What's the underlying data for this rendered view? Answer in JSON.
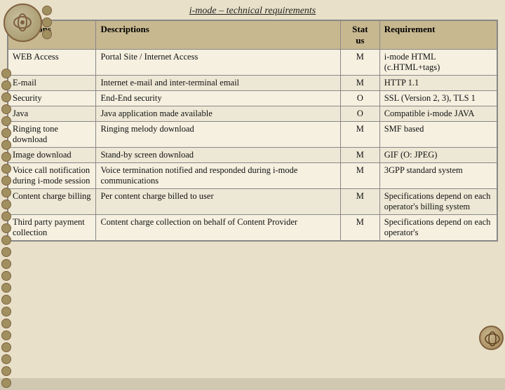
{
  "title": "i-mode – technical requirements",
  "headers": {
    "functions": "Functions",
    "descriptions": "Descriptions",
    "status": "Stat us",
    "requirement": "Requirement"
  },
  "rows": [
    {
      "function": "WEB Access",
      "description": "Portal Site / Internet Access",
      "status": "M",
      "requirement": "i-mode HTML (c.HTML+tags)"
    },
    {
      "function": "E-mail",
      "description": "Internet e-mail and inter-terminal email",
      "status": "M",
      "requirement": "HTTP 1.1"
    },
    {
      "function": "Security",
      "description": "End-End security",
      "status": "O",
      "requirement": "SSL (Version 2, 3), TLS 1"
    },
    {
      "function": "Java",
      "description": "Java application made available",
      "status": "O",
      "requirement": "Compatible i-mode JAVA"
    },
    {
      "function": "Ringing tone download",
      "description": "Ringing melody download",
      "status": "M",
      "requirement": "SMF based"
    },
    {
      "function": "Image download",
      "description": "Stand-by screen download",
      "status": "M",
      "requirement": "GIF (O: JPEG)"
    },
    {
      "function": "Voice call notification during i-mode session",
      "description": "Voice termination notified and responded during i-mode communications",
      "status": "M",
      "requirement": "3GPP standard system"
    },
    {
      "function": "Content charge billing",
      "description": "Per content charge billed to user",
      "status": "M",
      "requirement": "Specifications depend on each operator's billing system"
    },
    {
      "function": "Third party payment collection",
      "description": "Content charge collection on behalf of Content Provider",
      "status": "M",
      "requirement": "Specifications depend on each operator's"
    }
  ]
}
